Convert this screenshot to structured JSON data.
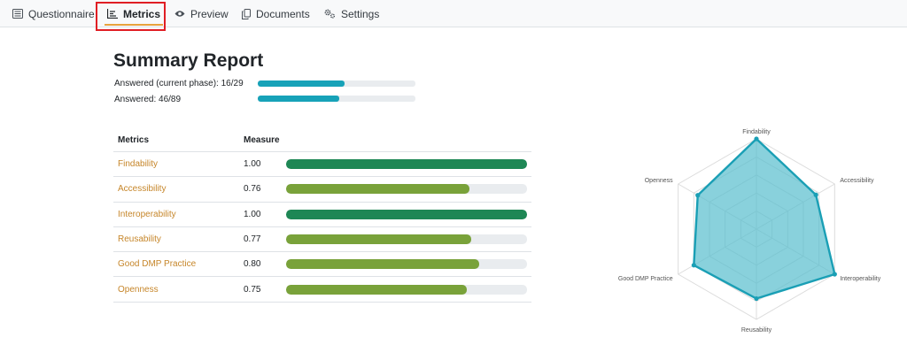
{
  "tabs": [
    {
      "label": "Questionnaire",
      "icon": "list-icon",
      "active": false
    },
    {
      "label": "Metrics",
      "icon": "chart-icon",
      "active": true
    },
    {
      "label": "Preview",
      "icon": "eye-icon",
      "active": false
    },
    {
      "label": "Documents",
      "icon": "copy-icon",
      "active": false
    },
    {
      "label": "Settings",
      "icon": "gears-icon",
      "active": false
    }
  ],
  "summary": {
    "title": "Summary Report",
    "progress": [
      {
        "label": "Answered (current phase): 16/29",
        "answered": 16,
        "total": 29
      },
      {
        "label": "Answered: 46/89",
        "answered": 46,
        "total": 89
      }
    ]
  },
  "metrics_table": {
    "headers": {
      "metric": "Metrics",
      "measure": "Measure"
    },
    "rows": [
      {
        "name": "Findability",
        "value": "1.00",
        "score": 1.0
      },
      {
        "name": "Accessibility",
        "value": "0.76",
        "score": 0.76
      },
      {
        "name": "Interoperability",
        "value": "1.00",
        "score": 1.0
      },
      {
        "name": "Reusability",
        "value": "0.77",
        "score": 0.77
      },
      {
        "name": "Good DMP Practice",
        "value": "0.80",
        "score": 0.8
      },
      {
        "name": "Openness",
        "value": "0.75",
        "score": 0.75
      }
    ]
  },
  "colors": {
    "progress": "#17a2b8",
    "full_score": "#1e8755",
    "partial_score": "#79a23a",
    "track": "#e9ecef",
    "link": "#c6862a",
    "radar_stroke": "#1a9fb5",
    "radar_fill": "#5bbfce"
  },
  "chart_data": {
    "type": "radar",
    "categories": [
      "Findability",
      "Accessibility",
      "Interoperability",
      "Reusability",
      "Good DMP Practice",
      "Openness"
    ],
    "series": [
      {
        "values": [
          1.0,
          0.76,
          1.0,
          0.77,
          0.8,
          0.75
        ]
      }
    ],
    "range": [
      0,
      1
    ]
  }
}
